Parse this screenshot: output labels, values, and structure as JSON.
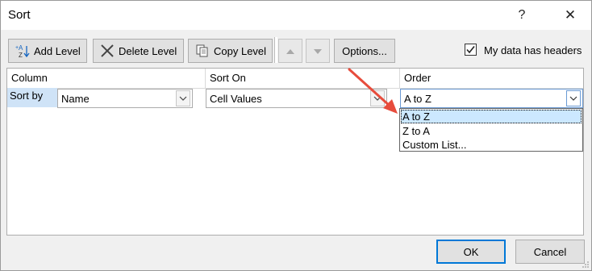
{
  "window": {
    "title": "Sort",
    "help": "?",
    "close": "✕"
  },
  "toolbar": {
    "add_level": "Add Level",
    "delete_level": "Delete Level",
    "copy_level": "Copy Level",
    "options": "Options...",
    "my_data_has_headers": "My data has headers",
    "headers_checked": true
  },
  "grid": {
    "headers": {
      "column": "Column",
      "sort_on": "Sort On",
      "order": "Order"
    },
    "row": {
      "label": "Sort by",
      "column_value": "Name",
      "sort_on_value": "Cell Values",
      "order_value": "A to Z"
    }
  },
  "order_dropdown": {
    "options": [
      "A to Z",
      "Z to A",
      "Custom List..."
    ],
    "highlighted": "A to Z"
  },
  "footer": {
    "ok": "OK",
    "cancel": "Cancel"
  },
  "colors": {
    "annotation_arrow": "#e74c3c",
    "selection": "#cce8ff",
    "focus_border": "#0078d7"
  }
}
